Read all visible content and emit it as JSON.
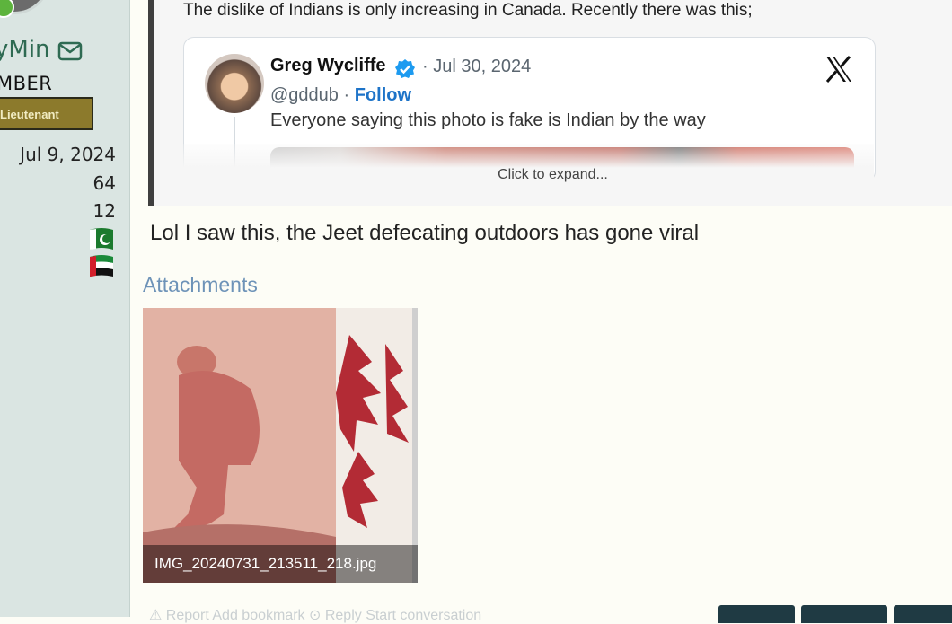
{
  "sidebar": {
    "username": "yMin",
    "role": "MBER",
    "rank": "Lieutenant",
    "join_date": "Jul 9, 2024",
    "messages": "64",
    "reactions": "12",
    "icons": {
      "mail": "mail-icon",
      "flag1": "pakistan-flag-icon",
      "flag2": "uae-flag-icon"
    }
  },
  "quote": {
    "text": "The dislike of Indians is only increasing in Canada. Recently there was this;",
    "expand": "Click to expand...",
    "tweet": {
      "name": "Greg Wycliffe",
      "date": "· Jul 30, 2024",
      "handle": "@gddub",
      "separator": "·",
      "follow": "Follow",
      "text": "Everyone saying this photo is fake is Indian by the way"
    }
  },
  "post": {
    "reply": "Lol I saw this, the Jeet defecating outdoors has gone viral"
  },
  "attachments": {
    "label": "Attachments",
    "filename": "IMG_20240731_213511_218.jpg"
  },
  "footer": {
    "actions": "⚠ Report  Add bookmark  ⊙ Reply  Start conversation"
  },
  "colors": {
    "sidebar": "#dae5e2",
    "accent": "#2e6a52",
    "link": "#1d73c8"
  }
}
